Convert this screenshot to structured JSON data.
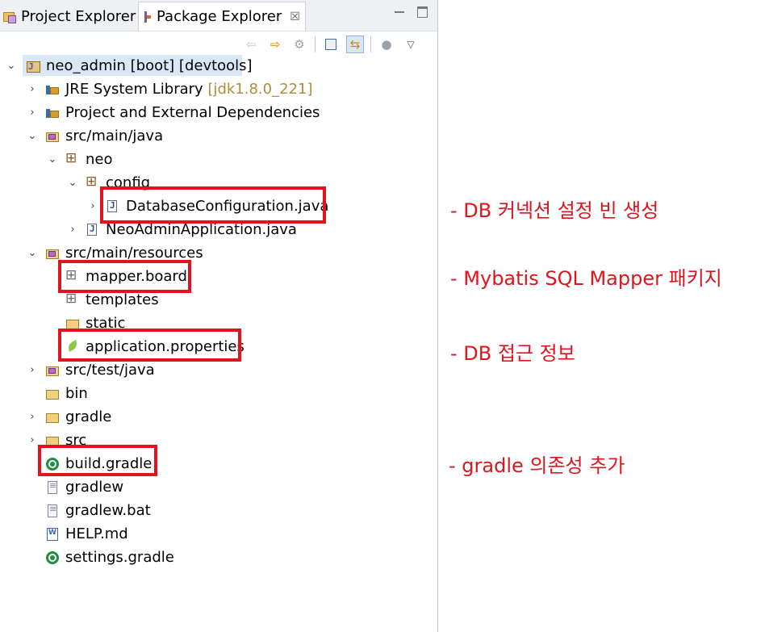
{
  "tabs": {
    "project_explorer": "Project Explorer",
    "package_explorer": "Package Explorer",
    "close_glyph": "☒"
  },
  "tree": {
    "project": {
      "name": "neo_admin",
      "decoration": "[boot] [devtools]"
    },
    "jre": {
      "name": "JRE System Library",
      "decoration": "[jdk1.8.0_221]"
    },
    "deps": "Project and External Dependencies",
    "src_main_java": "src/main/java",
    "pkg_neo": "neo",
    "pkg_config": "config",
    "database_configuration": "DatabaseConfiguration.java",
    "neo_admin_application": "NeoAdminApplication.java",
    "src_main_resources": "src/main/resources",
    "mapper_board": "mapper.board",
    "templates": "templates",
    "static": "static",
    "application_properties": "application.properties",
    "src_test_java": "src/test/java",
    "bin": "bin",
    "gradle": "gradle",
    "src": "src",
    "build_gradle": "build.gradle",
    "gradlew": "gradlew",
    "gradlew_bat": "gradlew.bat",
    "help_md": "HELP.md",
    "settings_gradle": "settings.gradle"
  },
  "annotations": {
    "db_config": "- DB 커넥션 설정 빈 생성",
    "mapper": "- Mybatis SQL Mapper 패키지",
    "db_access": "- DB 접근 정보",
    "gradle_deps": "- gradle 의존성 추가"
  },
  "colors": {
    "highlight": "#e0141c",
    "selection": "#d9e7f7",
    "decoration": "#b08d3c"
  },
  "icons": {
    "back": "back-arrow-icon",
    "forward": "forward-arrow-icon",
    "sync": "sync-icon",
    "collapse_all": "collapse-all-icon",
    "link_editor": "link-with-editor-icon",
    "filter": "filter-icon",
    "view_menu": "view-menu-icon"
  }
}
